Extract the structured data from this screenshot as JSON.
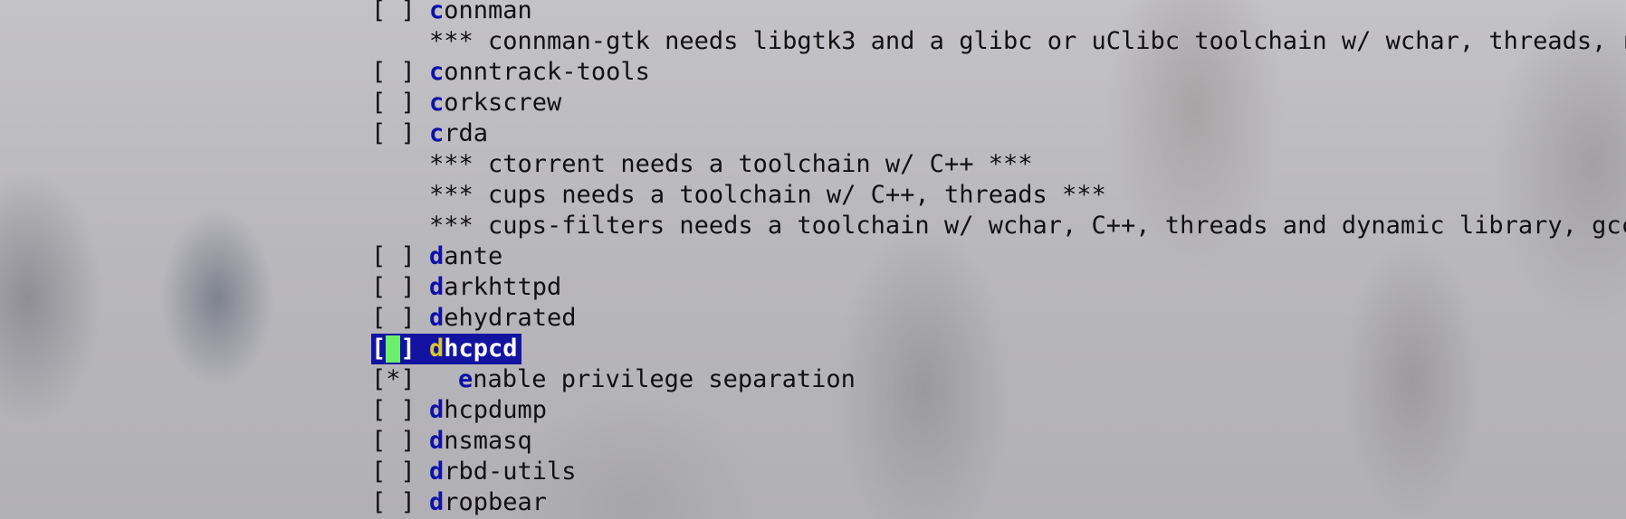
{
  "theme": {
    "hotkey_color": "#1010a8",
    "selection_background": "#1213a0",
    "selection_hotkey_color": "#d8c830",
    "cursor_color": "#6cf06c"
  },
  "menu": {
    "selected_index": 11,
    "items": [
      {
        "kind": "option",
        "checkbox": "[ ]",
        "hotkey": "c",
        "rest": "onnman"
      },
      {
        "kind": "comment",
        "text": "*** connman-gtk needs libgtk3 and a glibc or uClibc toolchain w/ wchar, threads, re"
      },
      {
        "kind": "option",
        "checkbox": "[ ]",
        "hotkey": "c",
        "rest": "onntrack-tools"
      },
      {
        "kind": "option",
        "checkbox": "[ ]",
        "hotkey": "c",
        "rest": "orkscrew"
      },
      {
        "kind": "option",
        "checkbox": "[ ]",
        "hotkey": "c",
        "rest": "rda"
      },
      {
        "kind": "comment",
        "text": "*** ctorrent needs a toolchain w/ C++ ***"
      },
      {
        "kind": "comment",
        "text": "*** cups needs a toolchain w/ C++, threads ***"
      },
      {
        "kind": "comment",
        "text": "*** cups-filters needs a toolchain w/ wchar, C++, threads and dynamic library, gcc"
      },
      {
        "kind": "option",
        "checkbox": "[ ]",
        "hotkey": "d",
        "rest": "ante"
      },
      {
        "kind": "option",
        "checkbox": "[ ]",
        "hotkey": "d",
        "rest": "arkhttpd"
      },
      {
        "kind": "option",
        "checkbox": "[ ]",
        "hotkey": "d",
        "rest": "ehydrated"
      },
      {
        "kind": "option",
        "checkbox": "[ ]",
        "hotkey": "d",
        "rest": "hcpcd",
        "selected": true
      },
      {
        "kind": "suboption",
        "checkbox": "[*]",
        "hotkey": "e",
        "rest": "nable privilege separation"
      },
      {
        "kind": "option",
        "checkbox": "[ ]",
        "hotkey": "d",
        "rest": "hcpdump"
      },
      {
        "kind": "option",
        "checkbox": "[ ]",
        "hotkey": "d",
        "rest": "nsmasq"
      },
      {
        "kind": "option",
        "checkbox": "[ ]",
        "hotkey": "d",
        "rest": "rbd-utils"
      },
      {
        "kind": "option",
        "checkbox": "[ ]",
        "hotkey": "d",
        "rest": "ropbear"
      }
    ]
  }
}
